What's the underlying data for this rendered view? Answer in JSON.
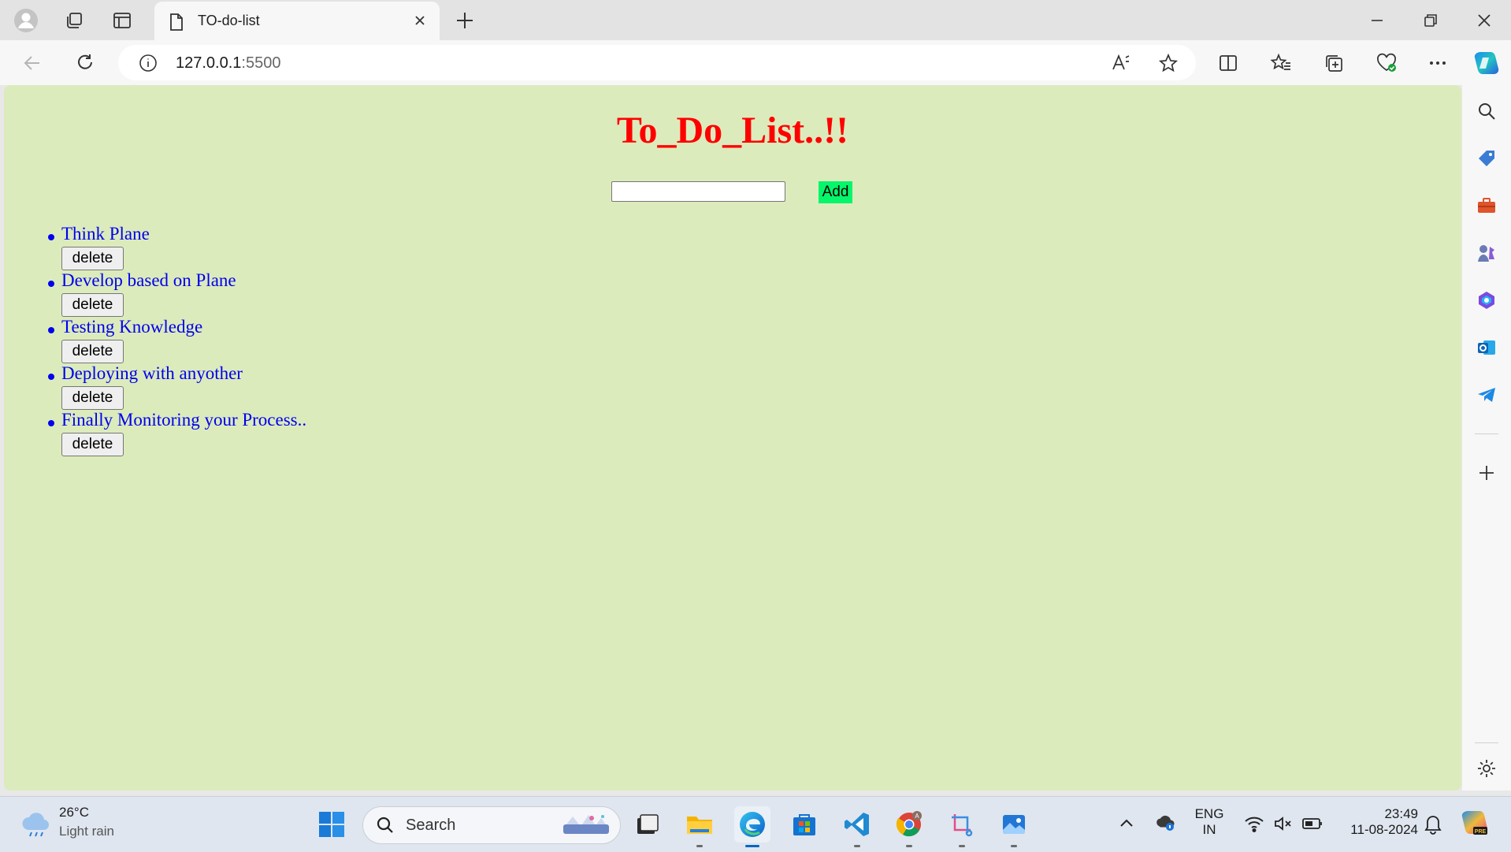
{
  "browser": {
    "tab": {
      "title": "TO-do-list"
    },
    "address": {
      "host": "127.0.0.1",
      "port": ":5500"
    }
  },
  "page": {
    "title": "To_Do_List..!!",
    "input": {
      "value": "",
      "placeholder": ""
    },
    "add_label": "Add",
    "tasks": [
      {
        "text": "Think Plane",
        "delete_label": "delete"
      },
      {
        "text": "Develop based on Plane",
        "delete_label": "delete"
      },
      {
        "text": "Testing Knowledge",
        "delete_label": "delete"
      },
      {
        "text": "Deploying with anyother",
        "delete_label": "delete"
      },
      {
        "text": "Finally Monitoring your Process..",
        "delete_label": "delete"
      }
    ],
    "colors": {
      "background": "#dcebbc",
      "title": "#ff0000",
      "task_text": "#0000ee",
      "add_button": "#05f56b"
    }
  },
  "taskbar": {
    "weather": {
      "temp": "26°C",
      "desc": "Light rain"
    },
    "search_label": "Search",
    "tray": {
      "lang_top": "ENG",
      "lang_bottom": "IN",
      "time": "23:49",
      "date": "11-08-2024"
    }
  },
  "icons": {
    "titlebar": [
      "profile-icon",
      "workspaces-icon",
      "tab-actions-icon",
      "page-icon",
      "close-icon",
      "plus-icon",
      "minimize-icon",
      "restore-icon",
      "close-icon"
    ],
    "toolbar": [
      "back-icon",
      "refresh-icon",
      "info-icon",
      "read-aloud-icon",
      "star-icon",
      "split-screen-icon",
      "favorites-icon",
      "collections-icon",
      "browser-essentials-icon",
      "more-icon",
      "copilot-icon"
    ],
    "sidebar": [
      "search-icon",
      "shopping-icon",
      "tools-icon",
      "games-icon",
      "microsoft365-icon",
      "outlook-icon",
      "telegram-icon",
      "plus-icon",
      "gear-icon"
    ],
    "taskbar": [
      "windows-start-icon",
      "search-icon",
      "task-view-icon",
      "file-explorer-icon",
      "edge-icon",
      "store-icon",
      "vscode-icon",
      "chrome-icon",
      "snipping-tool-icon",
      "photos-icon"
    ]
  }
}
